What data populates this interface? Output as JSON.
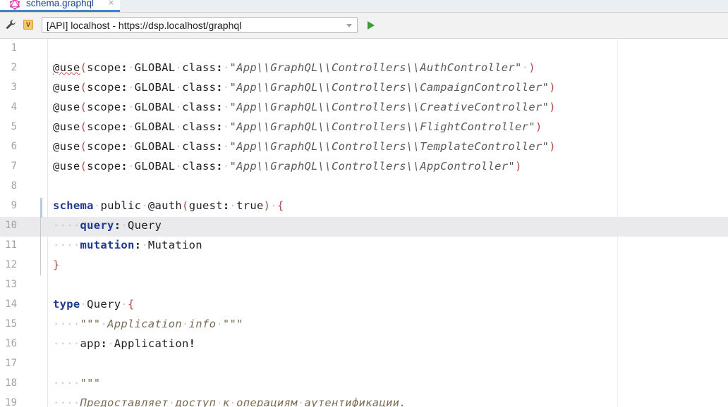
{
  "tab": {
    "title": "schema.graphql",
    "close": "×"
  },
  "toolbar": {
    "badge": "V",
    "endpoint": "[API] localhost - https://dsp.localhost/graphql"
  },
  "colors": {
    "accent": "#4083c9",
    "run": "#3b9a3b",
    "keyword": "#1f3a8c"
  },
  "icons": [
    "graphql-icon",
    "wrench-icon",
    "dropdown-arrow-icon",
    "play-icon"
  ],
  "editor": {
    "lines": [
      {
        "n": "1",
        "tokens": []
      },
      {
        "n": "2",
        "tokens": [
          [
            "dir squiggle",
            "@use"
          ],
          [
            "punc",
            "("
          ],
          [
            "",
            "scope"
          ],
          [
            "bold",
            ":"
          ],
          [
            "ws",
            "·"
          ],
          [
            "",
            "GLOBAL"
          ],
          [
            "ws",
            "·"
          ],
          [
            "",
            "class"
          ],
          [
            "bold",
            ":"
          ],
          [
            "ws",
            "·"
          ],
          [
            "str",
            "\"App\\\\GraphQL\\\\Controllers\\\\AuthController\""
          ],
          [
            "ws",
            "·"
          ],
          [
            "punc",
            ")"
          ]
        ]
      },
      {
        "n": "3",
        "tokens": [
          [
            "dir",
            "@use"
          ],
          [
            "punc",
            "("
          ],
          [
            "",
            "scope"
          ],
          [
            "bold",
            ":"
          ],
          [
            "ws",
            "·"
          ],
          [
            "",
            "GLOBAL"
          ],
          [
            "ws",
            "·"
          ],
          [
            "",
            "class"
          ],
          [
            "bold",
            ":"
          ],
          [
            "ws",
            "·"
          ],
          [
            "str",
            "\"App\\\\GraphQL\\\\Controllers\\\\CampaignController\""
          ],
          [
            "punc",
            ")"
          ]
        ]
      },
      {
        "n": "4",
        "tokens": [
          [
            "dir",
            "@use"
          ],
          [
            "punc",
            "("
          ],
          [
            "",
            "scope"
          ],
          [
            "bold",
            ":"
          ],
          [
            "ws",
            "·"
          ],
          [
            "",
            "GLOBAL"
          ],
          [
            "ws",
            "·"
          ],
          [
            "",
            "class"
          ],
          [
            "bold",
            ":"
          ],
          [
            "ws",
            "·"
          ],
          [
            "str",
            "\"App\\\\GraphQL\\\\Controllers\\\\CreativeController\""
          ],
          [
            "punc",
            ")"
          ]
        ]
      },
      {
        "n": "5",
        "tokens": [
          [
            "dir",
            "@use"
          ],
          [
            "punc",
            "("
          ],
          [
            "",
            "scope"
          ],
          [
            "bold",
            ":"
          ],
          [
            "ws",
            "·"
          ],
          [
            "",
            "GLOBAL"
          ],
          [
            "ws",
            "·"
          ],
          [
            "",
            "class"
          ],
          [
            "bold",
            ":"
          ],
          [
            "ws",
            "·"
          ],
          [
            "str",
            "\"App\\\\GraphQL\\\\Controllers\\\\FlightController\""
          ],
          [
            "punc",
            ")"
          ]
        ]
      },
      {
        "n": "6",
        "tokens": [
          [
            "dir",
            "@use"
          ],
          [
            "punc",
            "("
          ],
          [
            "",
            "scope"
          ],
          [
            "bold",
            ":"
          ],
          [
            "ws",
            "·"
          ],
          [
            "",
            "GLOBAL"
          ],
          [
            "ws",
            "·"
          ],
          [
            "",
            "class"
          ],
          [
            "bold",
            ":"
          ],
          [
            "ws",
            "·"
          ],
          [
            "str",
            "\"App\\\\GraphQL\\\\Controllers\\\\TemplateController\""
          ],
          [
            "punc",
            ")"
          ]
        ]
      },
      {
        "n": "7",
        "tokens": [
          [
            "dir",
            "@use"
          ],
          [
            "punc",
            "("
          ],
          [
            "",
            "scope"
          ],
          [
            "bold",
            ":"
          ],
          [
            "ws",
            "·"
          ],
          [
            "",
            "GLOBAL"
          ],
          [
            "ws",
            "·"
          ],
          [
            "",
            "class"
          ],
          [
            "bold",
            ":"
          ],
          [
            "ws",
            "·"
          ],
          [
            "str",
            "\"App\\\\GraphQL\\\\Controllers\\\\AppController\""
          ],
          [
            "punc",
            ")"
          ]
        ]
      },
      {
        "n": "8",
        "tokens": []
      },
      {
        "n": "9",
        "tokens": [
          [
            "kw",
            "schema"
          ],
          [
            "ws",
            "·"
          ],
          [
            "",
            "public"
          ],
          [
            "ws",
            "·"
          ],
          [
            "",
            "@auth"
          ],
          [
            "punc",
            "("
          ],
          [
            "",
            "guest"
          ],
          [
            "bold",
            ":"
          ],
          [
            "ws",
            "·"
          ],
          [
            "",
            "true"
          ],
          [
            "punc",
            ")"
          ],
          [
            "ws",
            "·"
          ],
          [
            "punc",
            "{"
          ]
        ]
      },
      {
        "n": "10",
        "tokens": [
          [
            "ws",
            "····"
          ],
          [
            "kw",
            "query"
          ],
          [
            "bold",
            ":"
          ],
          [
            "ws",
            "·"
          ],
          [
            "",
            "Query"
          ]
        ]
      },
      {
        "n": "11",
        "tokens": [
          [
            "ws",
            "····"
          ],
          [
            "kw",
            "mutation"
          ],
          [
            "bold",
            ":"
          ],
          [
            "ws",
            "·"
          ],
          [
            "",
            "Mutation"
          ]
        ]
      },
      {
        "n": "12",
        "tokens": [
          [
            "punc",
            "}"
          ]
        ]
      },
      {
        "n": "13",
        "tokens": []
      },
      {
        "n": "14",
        "tokens": [
          [
            "kw",
            "type"
          ],
          [
            "ws",
            "·"
          ],
          [
            "",
            "Query"
          ],
          [
            "ws",
            "·"
          ],
          [
            "punc",
            "{"
          ]
        ]
      },
      {
        "n": "15",
        "tokens": [
          [
            "ws",
            "····"
          ],
          [
            "doc",
            "\"\"\""
          ],
          [
            "ws",
            "·"
          ],
          [
            "doc",
            "Application"
          ],
          [
            "ws",
            "·"
          ],
          [
            "doc",
            "info"
          ],
          [
            "ws",
            "·"
          ],
          [
            "doc",
            "\"\"\""
          ]
        ]
      },
      {
        "n": "16",
        "tokens": [
          [
            "ws",
            "····"
          ],
          [
            "",
            "app"
          ],
          [
            "bold",
            ":"
          ],
          [
            "ws",
            "·"
          ],
          [
            "",
            "Application"
          ],
          [
            "bold",
            "!"
          ]
        ]
      },
      {
        "n": "17",
        "tokens": []
      },
      {
        "n": "18",
        "tokens": [
          [
            "ws",
            "····"
          ],
          [
            "doc",
            "\"\"\""
          ]
        ]
      },
      {
        "n": "19",
        "tokens": [
          [
            "ws",
            "····"
          ],
          [
            "doc",
            "Предоставляет"
          ],
          [
            "ws",
            "·"
          ],
          [
            "doc",
            "доступ"
          ],
          [
            "ws",
            "·"
          ],
          [
            "doc",
            "к"
          ],
          [
            "ws",
            "·"
          ],
          [
            "doc",
            "операциям"
          ],
          [
            "ws",
            "·"
          ],
          [
            "doc",
            "аутентификации."
          ]
        ]
      }
    ]
  }
}
